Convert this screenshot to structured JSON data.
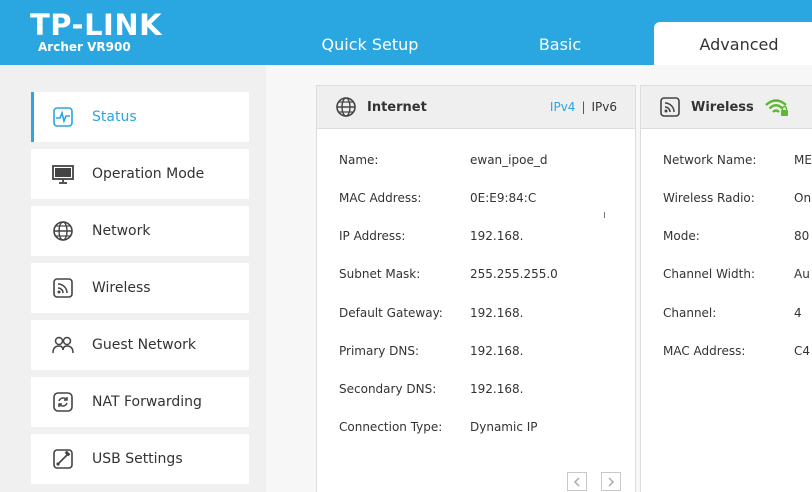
{
  "brand": {
    "logo": "TP-LINK",
    "model": "Archer VR900"
  },
  "nav": {
    "quick_setup": "Quick Setup",
    "basic": "Basic",
    "advanced": "Advanced"
  },
  "sidebar": {
    "items": [
      {
        "label": "Status",
        "icon": "status-icon",
        "active": true
      },
      {
        "label": "Operation Mode",
        "icon": "monitor-icon"
      },
      {
        "label": "Network",
        "icon": "globe-icon"
      },
      {
        "label": "Wireless",
        "icon": "wireless-icon"
      },
      {
        "label": "Guest Network",
        "icon": "guest-users-icon"
      },
      {
        "label": "NAT Forwarding",
        "icon": "nat-refresh-icon"
      },
      {
        "label": "USB Settings",
        "icon": "usb-icon"
      }
    ]
  },
  "internet": {
    "title": "Internet",
    "ipv4": "IPv4",
    "separator": "|",
    "ipv6": "IPv6",
    "rows": [
      {
        "label": "Name:",
        "value": "ewan_ipoe_d"
      },
      {
        "label": "MAC Address:",
        "value": "0E:E9:84:C"
      },
      {
        "label": "IP Address:",
        "value": "192.168."
      },
      {
        "label": "Subnet Mask:",
        "value": "255.255.255.0"
      },
      {
        "label": "Default Gateway:",
        "value": "192.168."
      },
      {
        "label": "Primary DNS:",
        "value": "192.168."
      },
      {
        "label": "Secondary DNS:",
        "value": "192.168."
      },
      {
        "label": "Connection Type:",
        "value": "Dynamic IP"
      }
    ]
  },
  "wireless": {
    "title": "Wireless",
    "rows": [
      {
        "label": "Network Name:",
        "value": "ME"
      },
      {
        "label": "Wireless Radio:",
        "value": "On"
      },
      {
        "label": "Mode:",
        "value": "80"
      },
      {
        "label": "Channel Width:",
        "value": "Au"
      },
      {
        "label": "Channel:",
        "value": "4"
      },
      {
        "label": "MAC Address:",
        "value": "C4"
      }
    ]
  },
  "colors": {
    "accent": "#2aa6e0",
    "sidebar_bg": "#f0f0f0",
    "card_header_bg": "#efefef",
    "wifi_green": "#5cb82e"
  }
}
